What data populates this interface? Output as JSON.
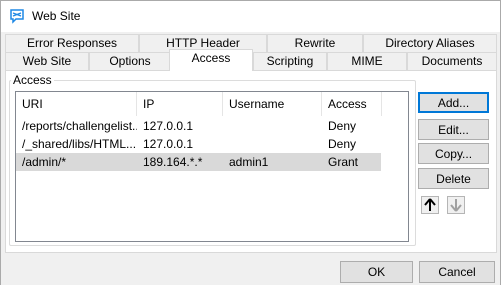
{
  "window": {
    "title": "Web Site",
    "icon": "web-site-icon"
  },
  "tabs_row1": [
    {
      "label": "Error Responses"
    },
    {
      "label": "HTTP Header"
    },
    {
      "label": "Rewrite"
    },
    {
      "label": "Directory Aliases"
    }
  ],
  "tabs_row2": [
    {
      "label": "Web Site"
    },
    {
      "label": "Options"
    },
    {
      "label": "Access",
      "active": true
    },
    {
      "label": "Scripting"
    },
    {
      "label": "MIME"
    },
    {
      "label": "Documents"
    }
  ],
  "access": {
    "group_label": "Access",
    "columns": [
      "URI",
      "IP",
      "Username",
      "Access"
    ],
    "rows": [
      {
        "uri": "/reports/challengelist...",
        "ip": "127.0.0.1",
        "username": "",
        "access": "Deny",
        "selected": false
      },
      {
        "uri": "/_shared/libs/HTML...",
        "ip": "127.0.0.1",
        "username": "",
        "access": "Deny",
        "selected": false
      },
      {
        "uri": "/admin/*",
        "ip": "189.164.*.*",
        "username": "admin1",
        "access": "Grant",
        "selected": true
      }
    ],
    "buttons": {
      "add": "Add...",
      "edit": "Edit...",
      "copy": "Copy...",
      "delete": "Delete"
    },
    "move_up_icon": "arrow-up-icon",
    "move_down_icon": "arrow-down-icon"
  },
  "footer": {
    "ok": "OK",
    "cancel": "Cancel"
  },
  "colors": {
    "selected_row": "#d9d9d9",
    "default_button_border": "#0078d7",
    "title_icon": "#1e88e5"
  }
}
